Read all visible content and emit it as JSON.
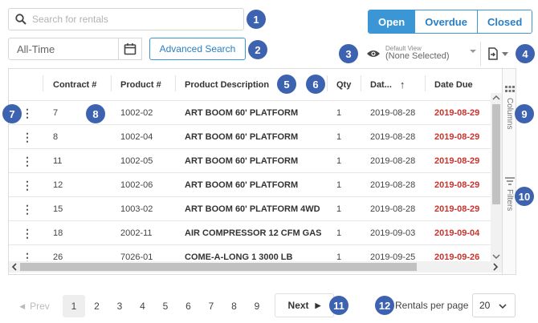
{
  "search": {
    "placeholder": "Search for rentals"
  },
  "status_tabs": [
    "Open",
    "Overdue",
    "Closed"
  ],
  "date_range": {
    "value": "All-Time"
  },
  "advanced_search_label": "Advanced Search",
  "saved_view": {
    "caption": "Default View",
    "value": "(None Selected)"
  },
  "columns": [
    "Contract #",
    "Product #",
    "Product Description",
    "Qty",
    "Dat...",
    "Date Due"
  ],
  "rows": [
    {
      "contract": "7",
      "product": "1002-02",
      "description": "ART BOOM 60' PLATFORM",
      "qty": "1",
      "date": "2019-08-28",
      "due": "2019-08-29"
    },
    {
      "contract": "8",
      "product": "1002-04",
      "description": "ART BOOM 60' PLATFORM",
      "qty": "1",
      "date": "2019-08-28",
      "due": "2019-08-29"
    },
    {
      "contract": "11",
      "product": "1002-05",
      "description": "ART BOOM 60' PLATFORM",
      "qty": "1",
      "date": "2019-08-28",
      "due": "2019-08-29"
    },
    {
      "contract": "12",
      "product": "1002-06",
      "description": "ART BOOM 60' PLATFORM",
      "qty": "1",
      "date": "2019-08-28",
      "due": "2019-08-29"
    },
    {
      "contract": "15",
      "product": "1003-02",
      "description": "ART BOOM 60' PLATFORM 4WD",
      "qty": "1",
      "date": "2019-08-28",
      "due": "2019-08-29"
    },
    {
      "contract": "18",
      "product": "2002-11",
      "description": "AIR COMPRESSOR 12 CFM GAS",
      "qty": "1",
      "date": "2019-09-03",
      "due": "2019-09-04"
    },
    {
      "contract": "26",
      "product": "7026-01",
      "description": "COME-A-LONG 1 3000 LB",
      "qty": "1",
      "date": "2019-09-25",
      "due": "2019-09-26"
    }
  ],
  "side_panels": [
    "Columns",
    "Filters"
  ],
  "pagination": {
    "prev_label": "Prev",
    "pages": [
      "1",
      "2",
      "3",
      "4",
      "5",
      "6",
      "7",
      "8",
      "9"
    ],
    "current": "1",
    "next_label": "Next",
    "rows_per_page_label": "Rentals per page",
    "rows_per_page": "20"
  },
  "callouts": [
    "1",
    "2",
    "3",
    "4",
    "5",
    "6",
    "7",
    "8",
    "9",
    "10",
    "11",
    "12"
  ],
  "colors": {
    "accent": "#3b96d6",
    "callout": "#3d62b0",
    "overdue": "#c9332d"
  }
}
